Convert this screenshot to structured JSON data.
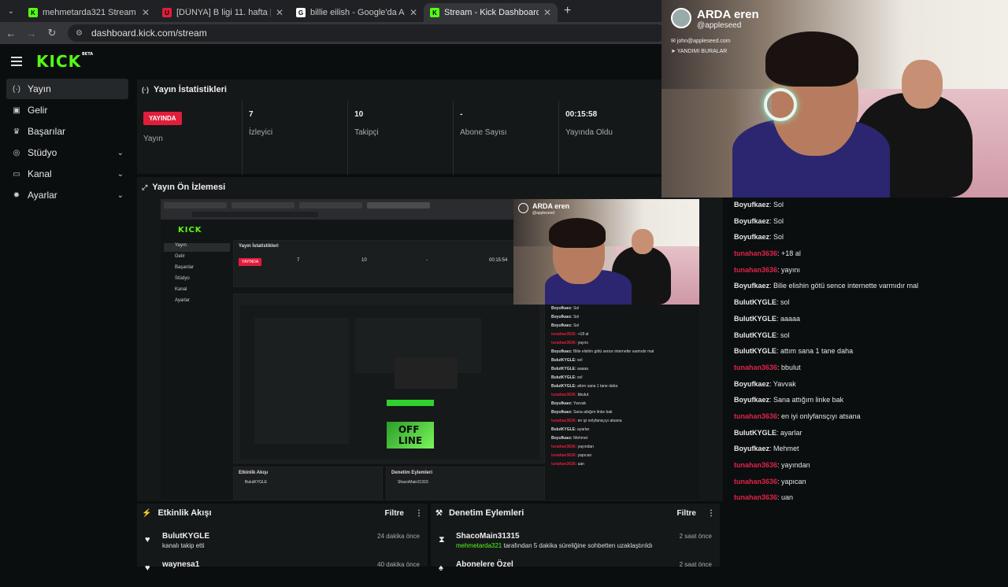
{
  "browser": {
    "tabs": [
      {
        "title": "mehmetarda321 Stream - Watch",
        "icon_color": "#53fc18",
        "icon_letter": "K"
      },
      {
        "title": "[DÜNYA] B ligi 11. hafta | UwUF",
        "icon_color": "#e01e3c",
        "icon_letter": "U"
      },
      {
        "title": "billie eilish - Google'da Ara",
        "icon_color": "#ffffff",
        "icon_letter": "G"
      },
      {
        "title": "Stream - Kick Dashboard",
        "icon_color": "#53fc18",
        "icon_letter": "K"
      }
    ],
    "url": "dashboard.kick.com/stream"
  },
  "header": {
    "logo": "KICK",
    "logo_tag": "BETA"
  },
  "sidebar": {
    "items": [
      {
        "label": "Yayın",
        "icon": "broadcast-icon",
        "glyph": "(·)",
        "active": true,
        "chevron": false
      },
      {
        "label": "Gelir",
        "icon": "revenue-icon",
        "glyph": "▣",
        "active": false,
        "chevron": false
      },
      {
        "label": "Başarılar",
        "icon": "trophy-icon",
        "glyph": "♛",
        "active": false,
        "chevron": false
      },
      {
        "label": "Stüdyo",
        "icon": "studio-icon",
        "glyph": "◎",
        "active": false,
        "chevron": true
      },
      {
        "label": "Kanal",
        "icon": "channel-icon",
        "glyph": "▭",
        "active": false,
        "chevron": true
      },
      {
        "label": "Ayarlar",
        "icon": "settings-icon",
        "glyph": "✹",
        "active": false,
        "chevron": true
      }
    ]
  },
  "stats_panel": {
    "title": "Yayın İstatistikleri",
    "stats": [
      {
        "value": "YAYINDA",
        "caption": "Yayın",
        "is_badge": true
      },
      {
        "value": "7",
        "caption": "İzleyici",
        "is_badge": false
      },
      {
        "value": "10",
        "caption": "Takipçi",
        "is_badge": false
      },
      {
        "value": "-",
        "caption": "Abone Sayısı",
        "is_badge": false
      },
      {
        "value": "00:15:58",
        "caption": "Yayında Oldu",
        "is_badge": false
      }
    ]
  },
  "preview_panel": {
    "title": "Yayın Ön İzlemesi"
  },
  "webcam": {
    "name": "ARDA eren",
    "handle": "@appleseed",
    "email": "john@appleseed.com",
    "location": "YANDIMI BURALAR"
  },
  "activity_panel": {
    "title": "Etkinlik Akışı",
    "filter_label": "Filtre",
    "events": [
      {
        "name": "BulutKYGLE",
        "sub": "kanalı takip etti",
        "time": "24 dakika önce"
      },
      {
        "name": "waynesa1",
        "sub": "",
        "time": "40 dakika önce"
      }
    ]
  },
  "moderation_panel": {
    "title": "Denetim Eylemleri",
    "filter_label": "Filtre",
    "events": [
      {
        "name": "ShacoMain31315",
        "actor": "mehmetarda321",
        "sub": " tarafından 5 dakika süreliğine sohbetten uzaklaştırıldı",
        "time": "2 saat önce"
      },
      {
        "name": "Abonelere Özel",
        "actor": "",
        "sub": "",
        "time": "2 saat önce"
      }
    ]
  },
  "chat": {
    "messages": [
      {
        "user": "Boyufkaez",
        "text": "Sol",
        "red": false
      },
      {
        "user": "Boyufkaez",
        "text": "Sol",
        "red": false
      },
      {
        "user": "Boyufkaez",
        "text": "Sol",
        "red": false
      },
      {
        "user": "tunahan3636",
        "text": "+18 al",
        "red": true
      },
      {
        "user": "tunahan3636",
        "text": "yayını",
        "red": true
      },
      {
        "user": "Boyufkaez",
        "text": "Bilie elishin götü sence internette varmıdır mal",
        "red": false
      },
      {
        "user": "BulutKYGLE",
        "text": "sol",
        "red": false
      },
      {
        "user": "BulutKYGLE",
        "text": "aaaaa",
        "red": false
      },
      {
        "user": "BulutKYGLE",
        "text": "sol",
        "red": false
      },
      {
        "user": "BulutKYGLE",
        "text": "attım sana 1 tane daha",
        "red": false
      },
      {
        "user": "tunahan3636",
        "text": "bbulut",
        "red": true
      },
      {
        "user": "Boyufkaez",
        "text": "Yavvak",
        "red": false
      },
      {
        "user": "Boyufkaez",
        "text": "Sana attığım linke bak",
        "red": false
      },
      {
        "user": "tunahan3636",
        "text": "en iyi onlyfansçıyı atsana",
        "red": true
      },
      {
        "user": "BulutKYGLE",
        "text": "ayarlar",
        "red": false
      },
      {
        "user": "Boyufkaez",
        "text": "Mehmet",
        "red": false
      },
      {
        "user": "tunahan3636",
        "text": "yayından",
        "red": true
      },
      {
        "user": "tunahan3636",
        "text": "yapıcan",
        "red": true
      },
      {
        "user": "tunahan3636",
        "text": "uan",
        "red": true
      }
    ]
  },
  "colors": {
    "accent": "#53fc18",
    "live": "#e01e3c",
    "chat_red": "#e0234a"
  }
}
